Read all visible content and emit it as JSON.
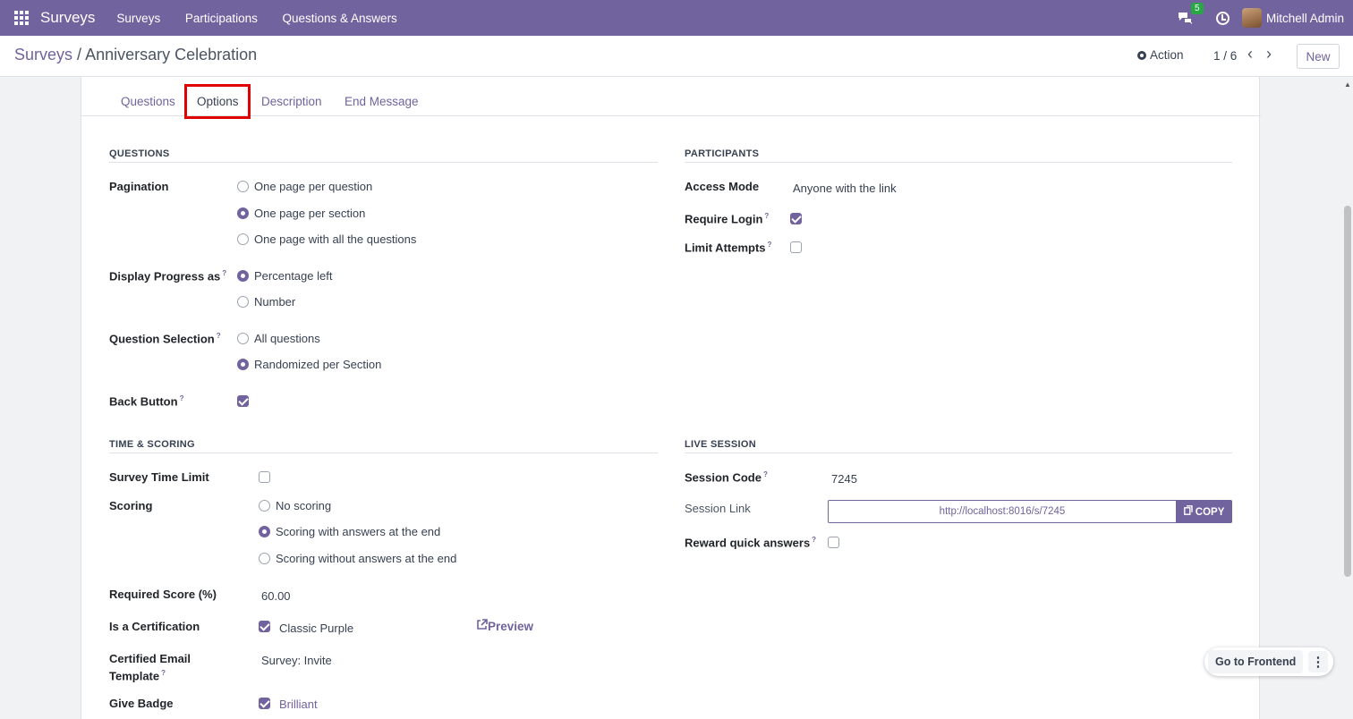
{
  "topbar": {
    "brand": "Surveys",
    "nav": [
      "Surveys",
      "Participations",
      "Questions & Answers"
    ],
    "chat_count": "5",
    "user": "Mitchell Admin",
    "color": "#71639e"
  },
  "control": {
    "breadcrumb_root": "Surveys",
    "breadcrumb_sep": "/",
    "breadcrumb_current": "Anniversary Celebration",
    "action": "Action",
    "pager": "1 / 6",
    "new": "New"
  },
  "tabs": [
    "Questions",
    "Options",
    "Description",
    "End Message"
  ],
  "questions_section": {
    "title": "QUESTIONS",
    "pagination_label": "Pagination",
    "pagination_options": [
      "One page per question",
      "One page per section",
      "One page with all the questions"
    ],
    "progress_label": "Display Progress as",
    "progress_options": [
      "Percentage left",
      "Number"
    ],
    "selection_label": "Question Selection",
    "selection_options": [
      "All questions",
      "Randomized per Section"
    ],
    "back_label": "Back Button"
  },
  "participants_section": {
    "title": "PARTICIPANTS",
    "access_label": "Access Mode",
    "access_value": "Anyone with the link",
    "login_label": "Require Login",
    "attempts_label": "Limit Attempts"
  },
  "time_section": {
    "title": "TIME & SCORING",
    "time_limit_label": "Survey Time Limit",
    "scoring_label": "Scoring",
    "scoring_options": [
      "No scoring",
      "Scoring with answers at the end",
      "Scoring without answers at the end"
    ],
    "required_label": "Required Score (%)",
    "required_value": "60.00",
    "cert_label": "Is a Certification",
    "cert_value": "Classic Purple",
    "preview": "Preview",
    "email_label_1": "Certified Email",
    "email_label_2": "Template",
    "email_value": "Survey: Invite",
    "badge_label": "Give Badge",
    "badge_value": "Brilliant"
  },
  "live_section": {
    "title": "LIVE SESSION",
    "code_label": "Session Code",
    "code_value": "7245",
    "link_label": "Session Link",
    "link_value": "http://localhost:8016/s/7245",
    "copy": "COPY",
    "reward_label": "Reward quick answers"
  },
  "float": {
    "go_frontend": "Go to Frontend",
    "more": "⋮"
  },
  "help_mark": "?"
}
